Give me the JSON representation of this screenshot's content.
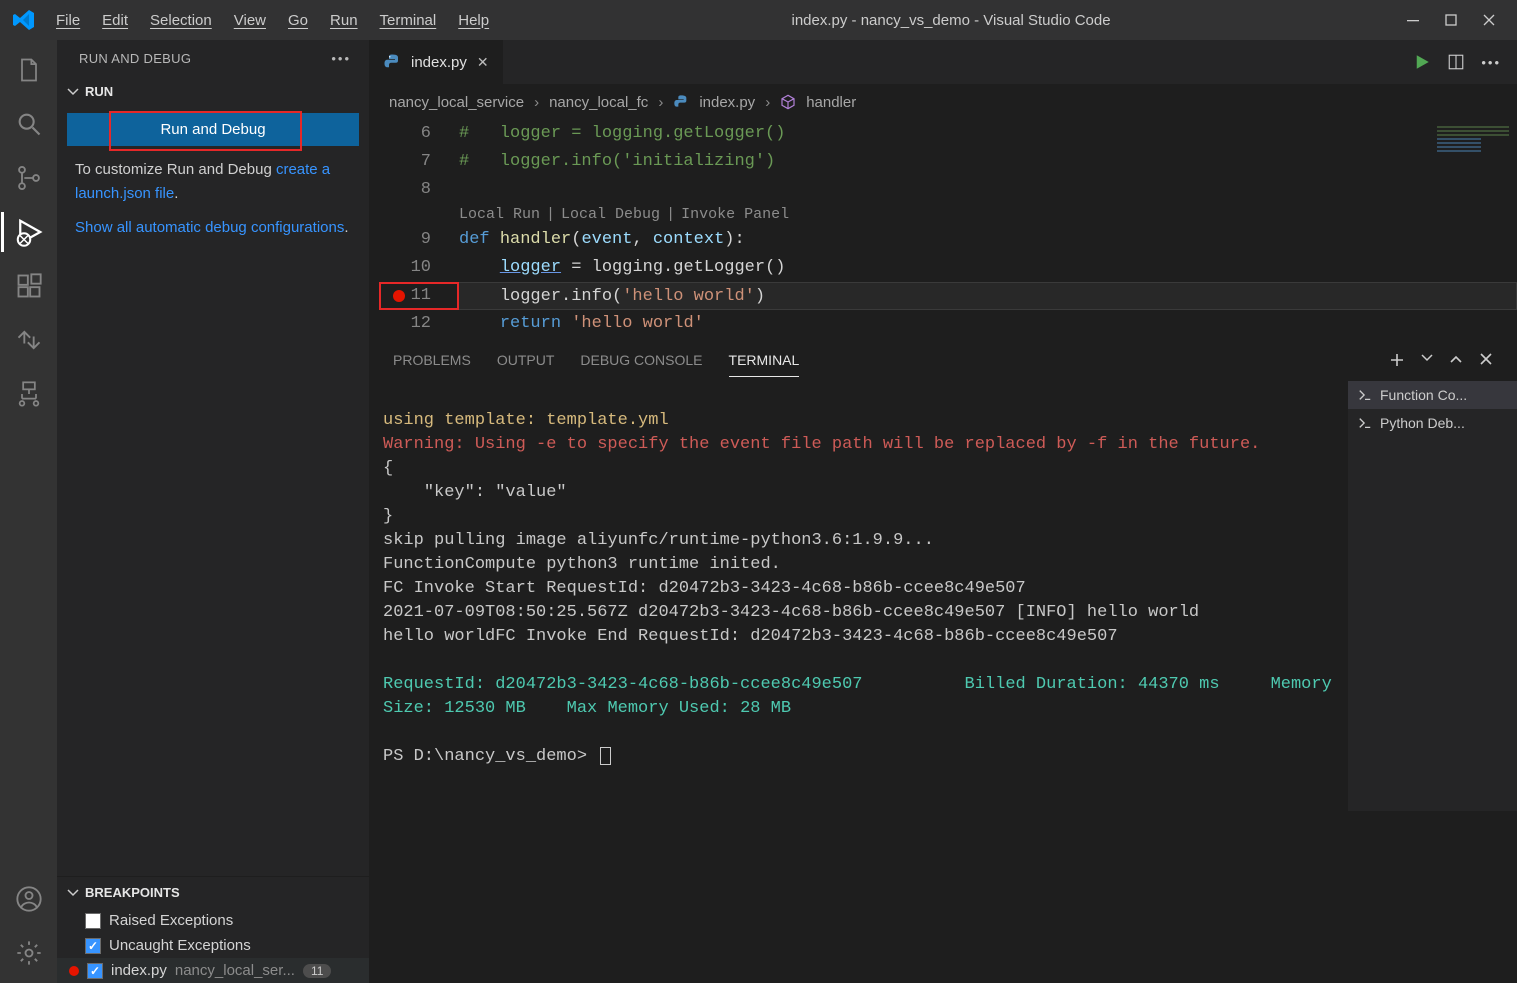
{
  "titlebar": {
    "menu": [
      "File",
      "Edit",
      "Selection",
      "View",
      "Go",
      "Run",
      "Terminal",
      "Help"
    ],
    "title": "index.py - nancy_vs_demo - Visual Studio Code"
  },
  "sidebar": {
    "header": "RUN AND DEBUG",
    "run_section": "RUN",
    "run_button": "Run and Debug",
    "customize_text": "To customize Run and Debug ",
    "launch_link": "create a launch.json file",
    "period": ".",
    "show_all_link": "Show all automatic debug configurations",
    "breakpoints_section": "BREAKPOINTS",
    "bp_raised": "Raised Exceptions",
    "bp_uncaught": "Uncaught Exceptions",
    "bp_file": "index.py",
    "bp_file_sub": "nancy_local_ser...",
    "bp_badge": "11"
  },
  "tabs": {
    "file": "index.py"
  },
  "breadcrumb": {
    "p1": "nancy_local_service",
    "p2": "nancy_local_fc",
    "p3": "index.py",
    "p4": "handler"
  },
  "codelens": {
    "run": "Local Run",
    "debug": "Local Debug",
    "invoke": "Invoke Panel"
  },
  "code": {
    "l6": "#   logger = logging.getLogger()",
    "l7": "#   logger.info('initializing')",
    "l9a": "def ",
    "l9b": "handler",
    "l9c": "(",
    "l9d": "event",
    "l9e": ", ",
    "l9f": "context",
    "l9g": "):",
    "l10a": "logger",
    "l10b": " = logging.getLogger()",
    "l11a": "logger.info(",
    "l11b": "'hello world'",
    "l11c": ")",
    "l12a": "return ",
    "l12b": "'hello world'"
  },
  "linenums": {
    "l6": "6",
    "l7": "7",
    "l8": "8",
    "l9": "9",
    "l10": "10",
    "l11": "11",
    "l12": "12"
  },
  "panel": {
    "tabs": {
      "problems": "PROBLEMS",
      "output": "OUTPUT",
      "debug": "DEBUG CONSOLE",
      "terminal": "TERMINAL"
    }
  },
  "terminal": {
    "l1": "using template: template.yml",
    "l2": "Warning: Using -e to specify the event file path will be replaced by -f in the future.",
    "l3": "{",
    "l4": "    \"key\": \"value\"",
    "l5": "}",
    "l6": "skip pulling image aliyunfc/runtime-python3.6:1.9.9...",
    "l7": "FunctionCompute python3 runtime inited.",
    "l8": "FC Invoke Start RequestId: d20472b3-3423-4c68-b86b-ccee8c49e507",
    "l9": "2021-07-09T08:50:25.567Z d20472b3-3423-4c68-b86b-ccee8c49e507 [INFO] hello world",
    "l10": "hello worldFC Invoke End RequestId: d20472b3-3423-4c68-b86b-ccee8c49e507",
    "s1a": "RequestId: d20472b3-3423-4c68-b86b-ccee8c49e507",
    "s1b": "Billed Duration: 44370 ms",
    "s2": "Memory Size: 12530 MB",
    "s3": "Max Memory Used: 28 MB",
    "prompt": "PS D:\\nancy_vs_demo> "
  },
  "term_sidebar": {
    "item1": "Function Co...",
    "item2": "Python Deb..."
  }
}
